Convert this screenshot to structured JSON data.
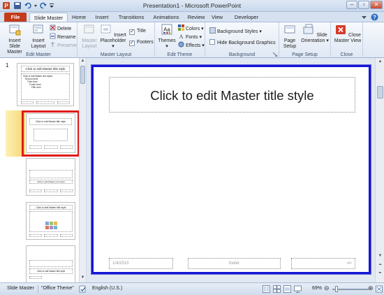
{
  "window": {
    "title": "Presentation1 - Microsoft PowerPoint"
  },
  "tabs": [
    "File",
    "Slide Master",
    "Home",
    "Insert",
    "Transitions",
    "Animations",
    "Review",
    "View",
    "Developer"
  ],
  "ribbon": {
    "edit_master": {
      "label": "Edit Master",
      "insert_slide_master": "Insert Slide Master",
      "insert_layout": "Insert Layout",
      "delete": "Delete",
      "rename": "Rename",
      "preserve": "Preserve"
    },
    "master_layout": {
      "label": "Master Layout",
      "master_layout_btn": "Master Layout",
      "insert_placeholder": "Insert Placeholder",
      "title": "Title",
      "footers": "Footers"
    },
    "edit_theme": {
      "label": "Edit Theme",
      "themes": "Themes",
      "colors": "Colors",
      "fonts": "Fonts",
      "effects": "Effects"
    },
    "background": {
      "label": "Background",
      "background_styles": "Background Styles",
      "hide_background_graphics": "Hide Background Graphics"
    },
    "page_setup": {
      "label": "Page Setup",
      "page_setup_btn": "Page Setup",
      "slide_orientation": "Slide Orientation"
    },
    "close": {
      "label": "Close",
      "close_master_view": "Close Master View"
    }
  },
  "thumbnails": {
    "number": "1",
    "title_text": "Click to edit Master title style",
    "body_lines": [
      "Click to edit Master text styles",
      "Second level",
      "Third level",
      "Fourth level",
      "Fifth level"
    ]
  },
  "slide": {
    "title": "Click to edit Master title style",
    "date": "1/4/2013",
    "footer": "footer",
    "page_number": "‹#›"
  },
  "status": {
    "view": "Slide Master",
    "theme": "\"Office Theme\"",
    "language": "English (U.S.)",
    "zoom": "69%"
  },
  "colors": {
    "accent": "#c33b1c",
    "selection": "#e01b1b",
    "slide_border": "#1515d6"
  }
}
